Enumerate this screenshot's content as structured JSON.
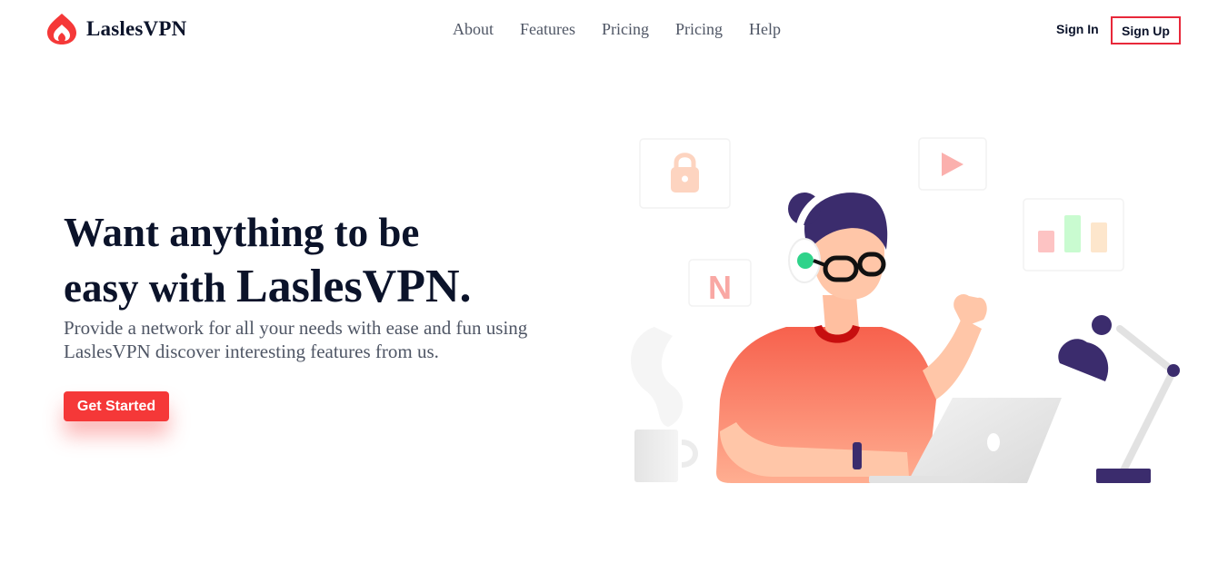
{
  "brand": {
    "name": "LaslesVPN",
    "accent": "#f53838"
  },
  "nav": {
    "items": [
      "About",
      "Features",
      "Pricing",
      "Pricing",
      "Help"
    ]
  },
  "auth": {
    "signin_label": "Sign In",
    "signup_label": "Sign Up"
  },
  "hero": {
    "title_line1": "Want anything to be",
    "title_line2_prefix": "easy with ",
    "title_line2_brand": "LaslesVPN.",
    "description": "Provide a network for all your needs with ease and fun using LaslesVPN discover interesting features from us.",
    "cta_label": "Get Started"
  },
  "illustration": {
    "icons": [
      "lock-icon",
      "play-icon",
      "netflix-n-icon",
      "bar-chart-icon"
    ],
    "netflix_letter": "N"
  }
}
